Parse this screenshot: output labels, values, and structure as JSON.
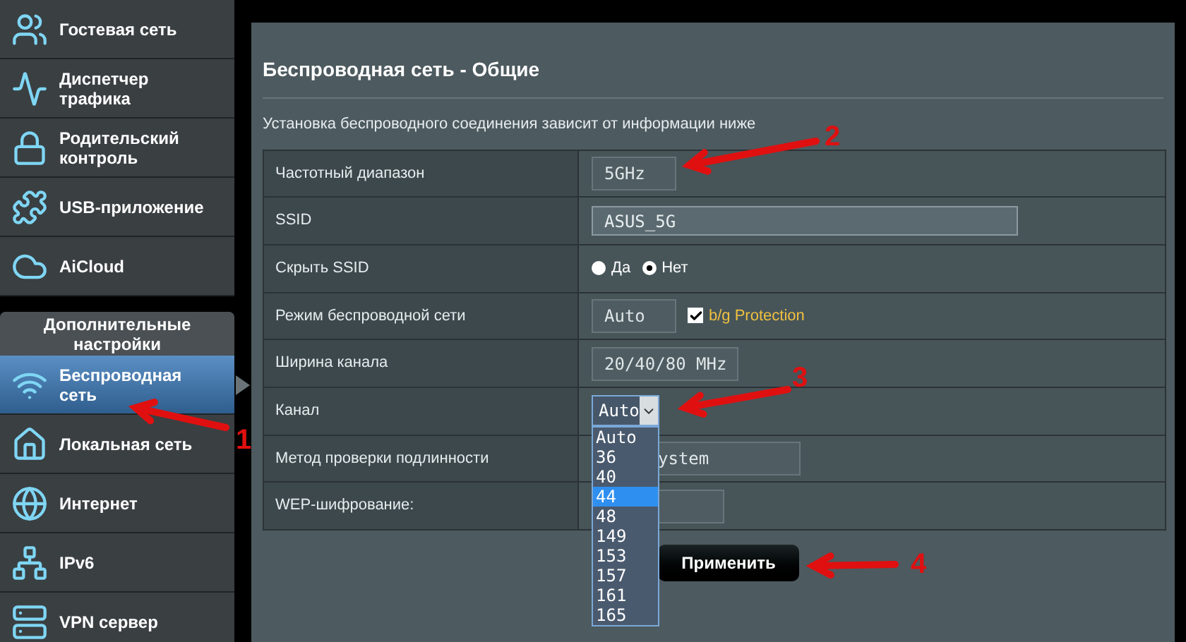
{
  "sidebar": {
    "items": [
      {
        "label": "Гостевая сеть",
        "selected": false
      },
      {
        "label": "Диспетчер трафика",
        "selected": false
      },
      {
        "label": "Родительский контроль",
        "selected": false
      },
      {
        "label": "USB-приложение",
        "selected": false
      },
      {
        "label": "AiCloud",
        "selected": false
      }
    ],
    "section": {
      "title": "Дополнительные настройки",
      "items": [
        {
          "label": "Беспроводная сеть",
          "selected": true
        },
        {
          "label": "Локальная сеть",
          "selected": false
        },
        {
          "label": "Интернет",
          "selected": false
        },
        {
          "label": "IPv6",
          "selected": false
        },
        {
          "label": "VPN сервер",
          "selected": false
        }
      ]
    }
  },
  "page": {
    "title": "Беспроводная сеть - Общие",
    "subtitle": "Установка беспроводного соединения зависит от информации ниже",
    "rows": [
      {
        "label": "Частотный диапазон",
        "kind": "select",
        "value": "5GHz"
      },
      {
        "label": "SSID",
        "kind": "text",
        "value": "ASUS_5G"
      },
      {
        "label": "Скрыть SSID",
        "kind": "radio",
        "options": [
          {
            "label": "Да",
            "selected": false
          },
          {
            "label": "Нет",
            "selected": true
          }
        ]
      },
      {
        "label": "Режим беспроводной сети",
        "kind": "select",
        "value": "Auto",
        "checkbox": {
          "label": "b/g Protection",
          "checked": true
        }
      },
      {
        "label": "Ширина канала",
        "kind": "select",
        "value": "20/40/80 MHz"
      },
      {
        "label": "Канал",
        "kind": "dropdown",
        "value": "Auto",
        "expanded": true,
        "options": [
          {
            "label": "Auto",
            "highlighted": false
          },
          {
            "label": "36",
            "highlighted": false
          },
          {
            "label": "40",
            "highlighted": false
          },
          {
            "label": "44",
            "highlighted": true
          },
          {
            "label": "48",
            "highlighted": false
          },
          {
            "label": "149",
            "highlighted": false
          },
          {
            "label": "153",
            "highlighted": false
          },
          {
            "label": "157",
            "highlighted": false
          },
          {
            "label": "161",
            "highlighted": false
          },
          {
            "label": "165",
            "highlighted": false
          }
        ]
      },
      {
        "label": "Метод проверки подлинности",
        "kind": "select",
        "value": "ystem"
      },
      {
        "label": "WEP-шифрование:",
        "kind": "select"
      }
    ],
    "apply_button": "Применить"
  },
  "annotations": [
    {
      "label": "1"
    },
    {
      "label": "2"
    },
    {
      "label": "3"
    },
    {
      "label": "4"
    }
  ]
}
